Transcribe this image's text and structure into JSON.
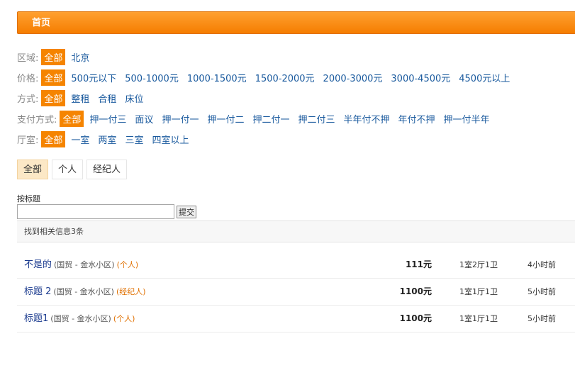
{
  "header": {
    "title": "首页"
  },
  "filters": [
    {
      "label": "区域:",
      "options": [
        "全部",
        "北京"
      ]
    },
    {
      "label": "价格:",
      "options": [
        "全部",
        "500元以下",
        "500-1000元",
        "1000-1500元",
        "1500-2000元",
        "2000-3000元",
        "3000-4500元",
        "4500元以上"
      ]
    },
    {
      "label": "方式:",
      "options": [
        "全部",
        "整租",
        "合租",
        "床位"
      ]
    },
    {
      "label": "支付方式:",
      "options": [
        "全部",
        "押一付三",
        "面议",
        "押一付一",
        "押一付二",
        "押二付一",
        "押二付三",
        "半年付不押",
        "年付不押",
        "押一付半年"
      ]
    },
    {
      "label": "厅室:",
      "options": [
        "全部",
        "一室",
        "两室",
        "三室",
        "四室以上"
      ]
    }
  ],
  "type_tabs": [
    "全部",
    "个人",
    "经纪人"
  ],
  "search": {
    "label": "按标题",
    "value": "",
    "button": "提交"
  },
  "result_summary": "找到相关信息3条",
  "listings": [
    {
      "title": "不是的",
      "location": "(国贸 - 金水小区)",
      "tag": "(个人)",
      "price": "111元",
      "layout": "1室2厅1卫",
      "time": "4小时前"
    },
    {
      "title": "标题 2",
      "location": "(国贸 - 金水小区)",
      "tag": "(经纪人)",
      "price": "1100元",
      "layout": "1室1厅1卫",
      "time": "5小时前"
    },
    {
      "title": "标题1",
      "location": "(国贸 - 金水小区)",
      "tag": "(个人)",
      "price": "1100元",
      "layout": "1室1厅1卫",
      "time": "5小时前"
    }
  ]
}
